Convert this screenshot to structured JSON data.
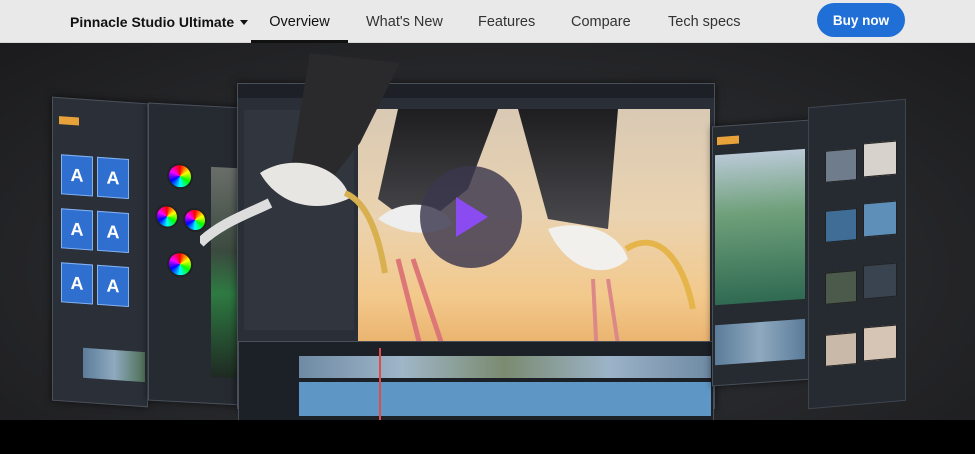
{
  "nav": {
    "brand": "Pinnacle Studio Ultimate",
    "links": [
      "Overview",
      "What's New",
      "Features",
      "Compare",
      "Tech specs"
    ],
    "active": "Overview",
    "cta": "Buy now"
  },
  "hero": {
    "thumb_letter": "A",
    "play_icon": "play-icon",
    "colors": {
      "accent": "#1f6fd6",
      "play": "#8a4bf0"
    }
  }
}
